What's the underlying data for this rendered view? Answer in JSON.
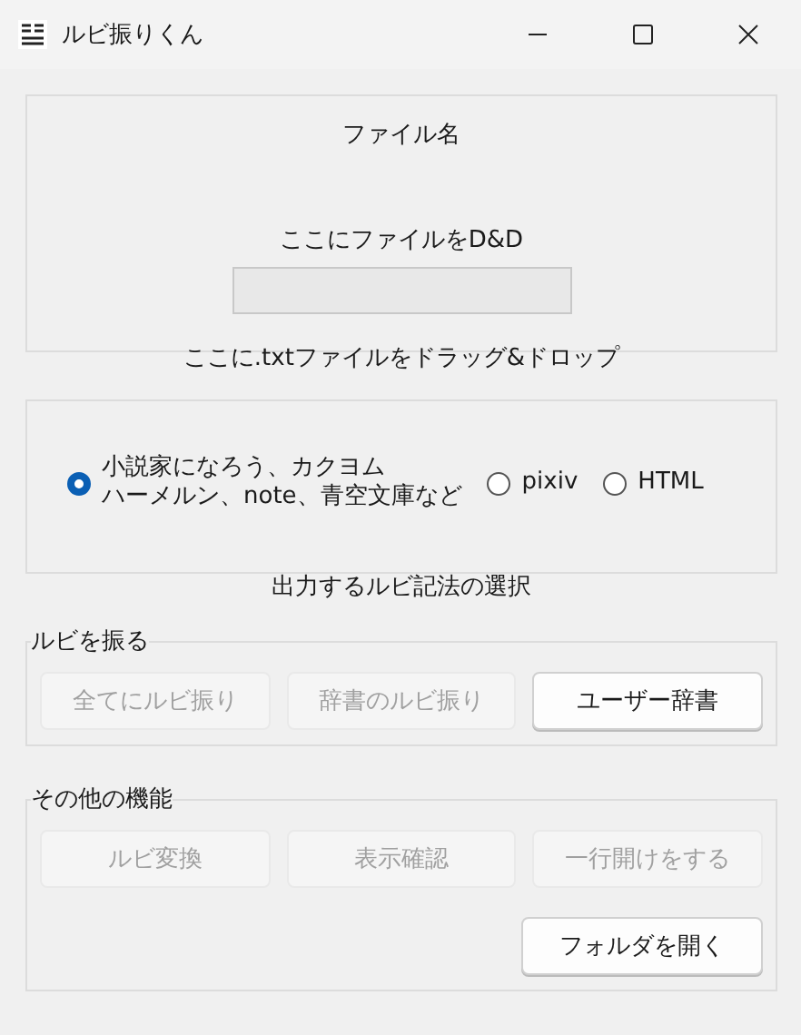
{
  "window": {
    "title": "ルビ振りくん"
  },
  "file_panel": {
    "file_name": "ファイル名",
    "drop_hint": "ここにファイルをD&D",
    "path_field": {
      "disabled": true
    },
    "caption": "ここに.txtファイルをドラッグ&ドロップ"
  },
  "notation": {
    "options": [
      {
        "lines": [
          "小説家になろう、カクヨム",
          "ハーメルン、note、青空文庫など"
        ],
        "selected": true
      },
      {
        "lines": [
          "pixiv"
        ],
        "selected": false
      },
      {
        "lines": [
          "HTML"
        ],
        "selected": false
      }
    ],
    "caption": "出力するルビ記法の選択"
  },
  "groups": [
    {
      "title": "ルビを振る",
      "buttons": [
        {
          "label": "全てにルビ振り",
          "disabled": true
        },
        {
          "label": "辞書のルビ振り",
          "disabled": true
        },
        {
          "label": "ユーザー辞書",
          "disabled": false
        }
      ]
    },
    {
      "title": "その他の機能",
      "buttons": [
        {
          "label": "ルビ変換",
          "disabled": true
        },
        {
          "label": "表示確認",
          "disabled": true
        },
        {
          "label": "一行開けをする",
          "disabled": true
        }
      ],
      "footer_button": {
        "label": "フォルダを開く",
        "disabled": false
      }
    }
  ]
}
